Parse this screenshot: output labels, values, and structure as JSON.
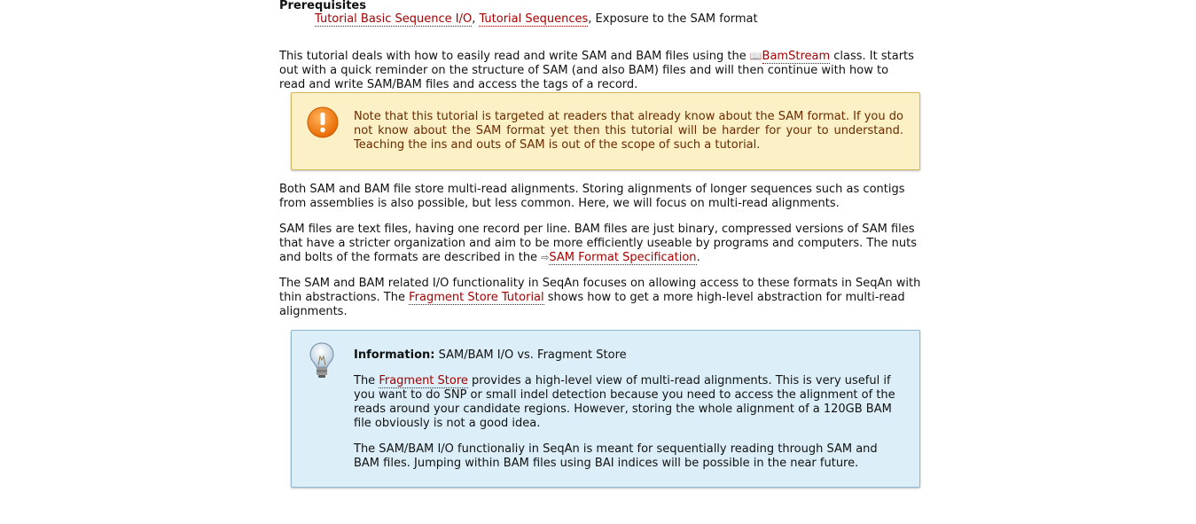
{
  "prereq": {
    "heading": "Prerequisites",
    "link1": "Tutorial Basic Sequence I/O",
    "sep1": ", ",
    "link2": "Tutorial Sequences",
    "tail": ", Exposure to the SAM format"
  },
  "intro": {
    "t1": "This tutorial deals with how to easily read and write SAM and BAM files using the ",
    "icon": "📖",
    "link": "BamStream",
    "t2": " class. It starts out with a quick reminder on the structure of SAM (and also BAM) files and will then continue with how to read and write SAM/BAM files and access the tags of a record."
  },
  "warning": {
    "icon": "warning-exclamation-icon",
    "text": "Note that this tutorial is targeted at readers that already know about the SAM format. If you do not know about the SAM format yet then this tutorial will be harder for your to understand. Teaching the ins and outs of SAM is out of the scope of such a tutorial."
  },
  "para2": "Both SAM and BAM file store multi-read alignments. Storing alignments of longer sequences such as contigs from assemblies is also possible, but less common. Here, we will focus on multi-read alignments.",
  "para3": {
    "t1": "SAM files are text files, having one record per line. BAM files are just binary, compressed versions of SAM files that have a stricter organization and aim to be more efficiently useable by programs and computers. The nuts and bolts of the formats are described in the ",
    "icon": "⇨",
    "link": "SAM Format Specification",
    "t2": "."
  },
  "para4": {
    "t1": "The SAM and BAM related I/O functionality in SeqAn focuses on allowing access to these formats in SeqAn with thin abstractions. The ",
    "link": "Fragment Store Tutorial",
    "t2": " shows how to get a more high-level abstraction for multi-read alignments."
  },
  "info": {
    "icon": "lightbulb-icon",
    "label": "Information:",
    "title": " SAM/BAM I/O vs. Fragment Store",
    "p1_t1": "The ",
    "p1_link": "Fragment Store",
    "p1_t2": " provides a high-level view of multi-read alignments. This is very useful if you want to do SNP or small indel detection because you need to access the alignment of the reads around your candidate regions. However, storing the whole alignment of a 120GB BAM file obviously is not a good idea.",
    "p2": "The SAM/BAM I/O functionaliy in SeqAn is meant for sequentially reading through SAM and BAM files. Jumping within BAM files using BAI indices will be possible in the near future."
  },
  "colors": {
    "link": "#a40000",
    "warning_bg": "#fbf0c6",
    "info_bg": "#dceff8"
  }
}
